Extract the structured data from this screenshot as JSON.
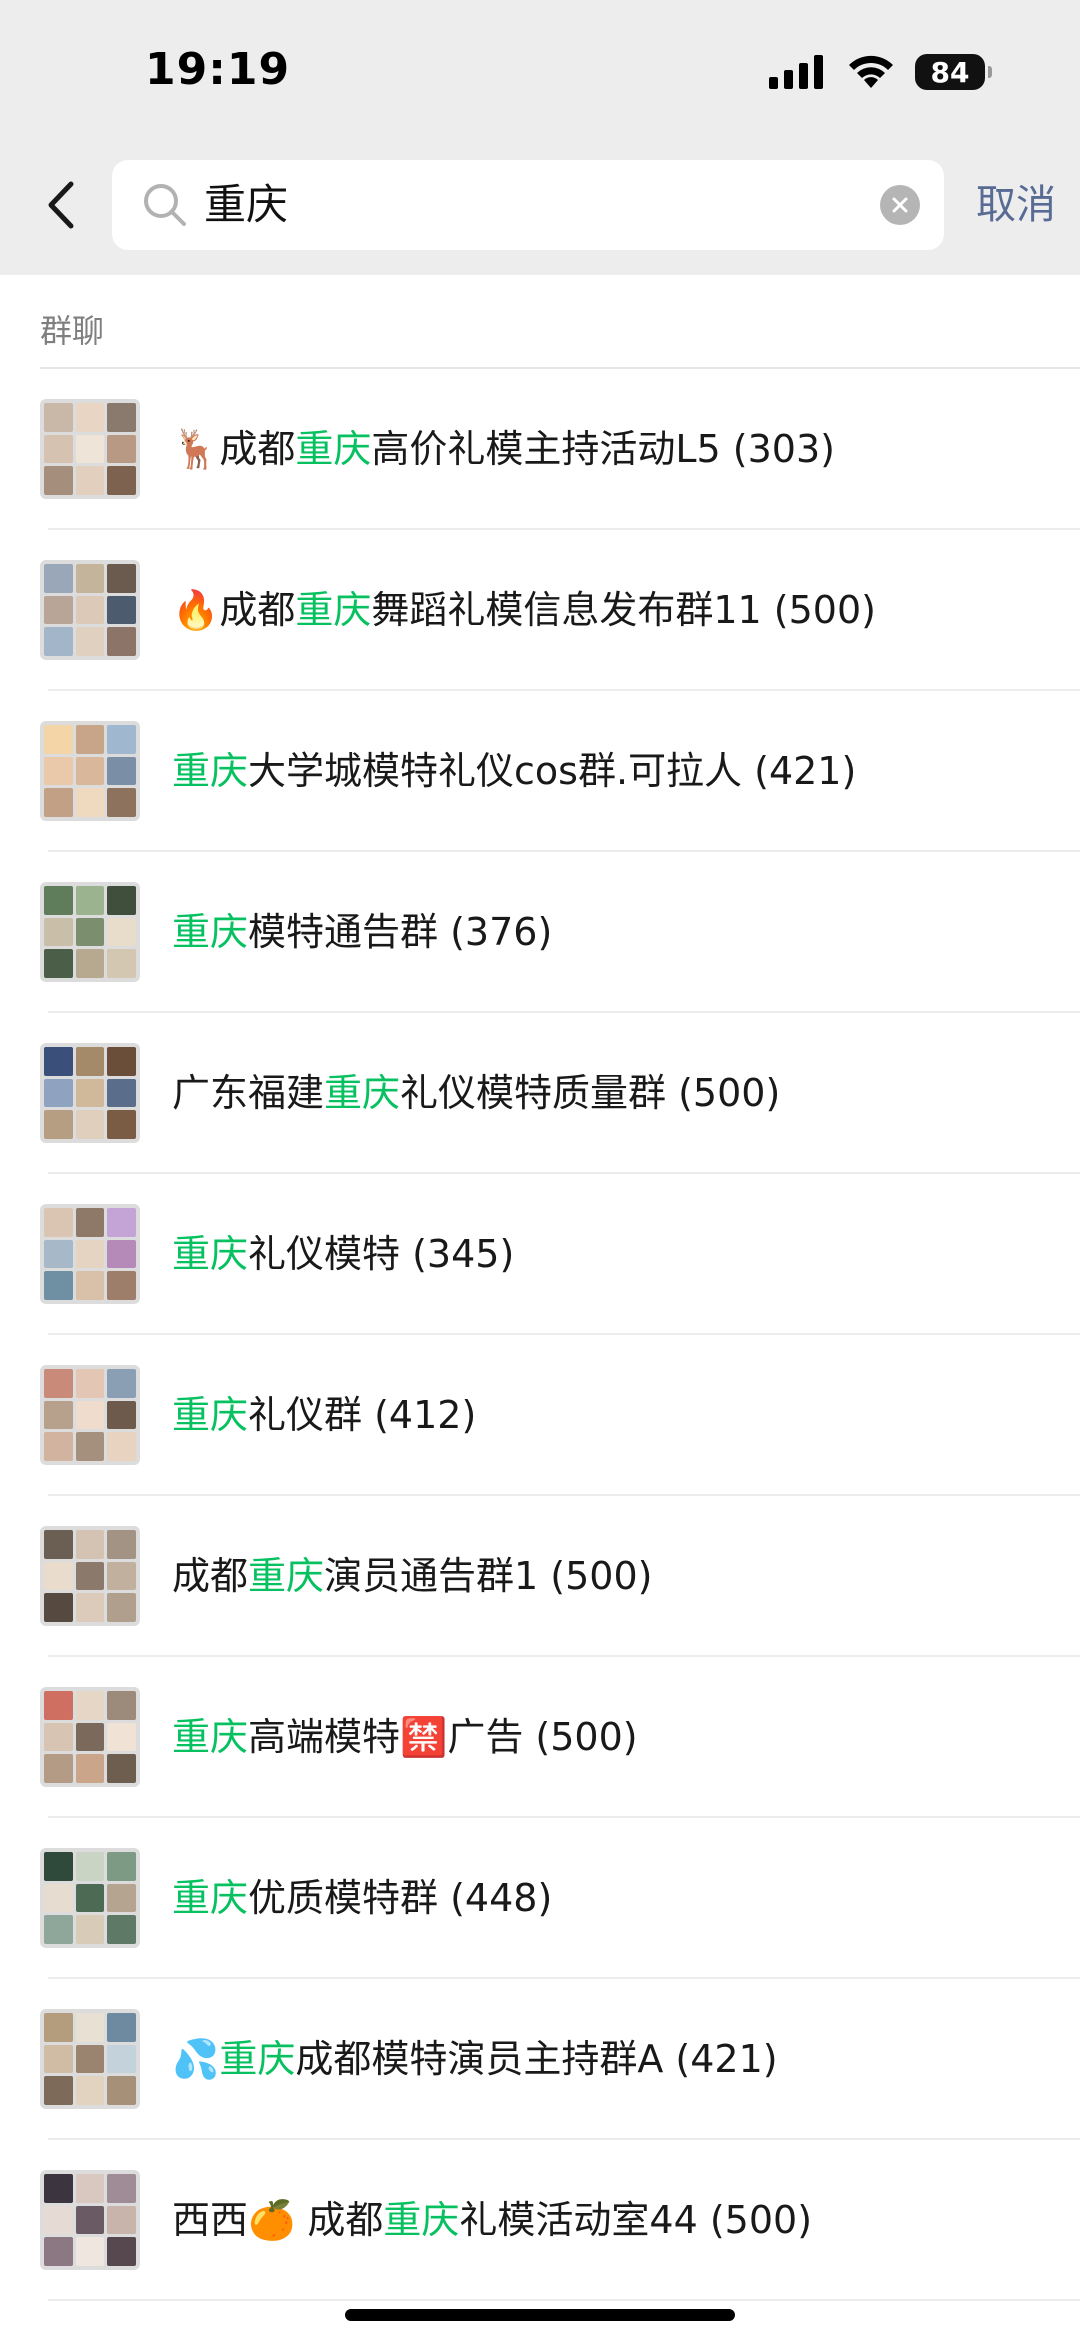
{
  "status_bar": {
    "time": "19:19",
    "battery": "84"
  },
  "search": {
    "query": "重庆",
    "cancel_label": "取消"
  },
  "section_title": "群聊",
  "highlight_color": "#07c160",
  "results": [
    {
      "prefix": "🦌成都",
      "highlight": "重庆",
      "suffix": "高价礼模主持活动L5 (303)"
    },
    {
      "prefix": "🔥成都",
      "highlight": "重庆",
      "suffix": "舞蹈礼模信息发布群11 (500)"
    },
    {
      "prefix": "",
      "highlight": "重庆",
      "suffix": "大学城模特礼仪cos群.可拉人 (421)"
    },
    {
      "prefix": "",
      "highlight": "重庆",
      "suffix": "模特通告群 (376)"
    },
    {
      "prefix": "广东福建",
      "highlight": "重庆",
      "suffix": "礼仪模特质量群 (500)"
    },
    {
      "prefix": "",
      "highlight": "重庆",
      "suffix": "礼仪模特 (345)"
    },
    {
      "prefix": "",
      "highlight": "重庆",
      "suffix": "礼仪群 (412)"
    },
    {
      "prefix": "成都",
      "highlight": "重庆",
      "suffix": "演员通告群1 (500)"
    },
    {
      "prefix": "",
      "highlight": "重庆",
      "suffix": "高端模特🈲广告 (500)"
    },
    {
      "prefix": "",
      "highlight": "重庆",
      "suffix": "优质模特群 (448)"
    },
    {
      "prefix": "💦",
      "highlight": "重庆",
      "suffix": "成都模特演员主持群A (421)"
    },
    {
      "prefix": "西西🍊 成都",
      "highlight": "重庆",
      "suffix": "礼模活动室44 (500)"
    }
  ]
}
